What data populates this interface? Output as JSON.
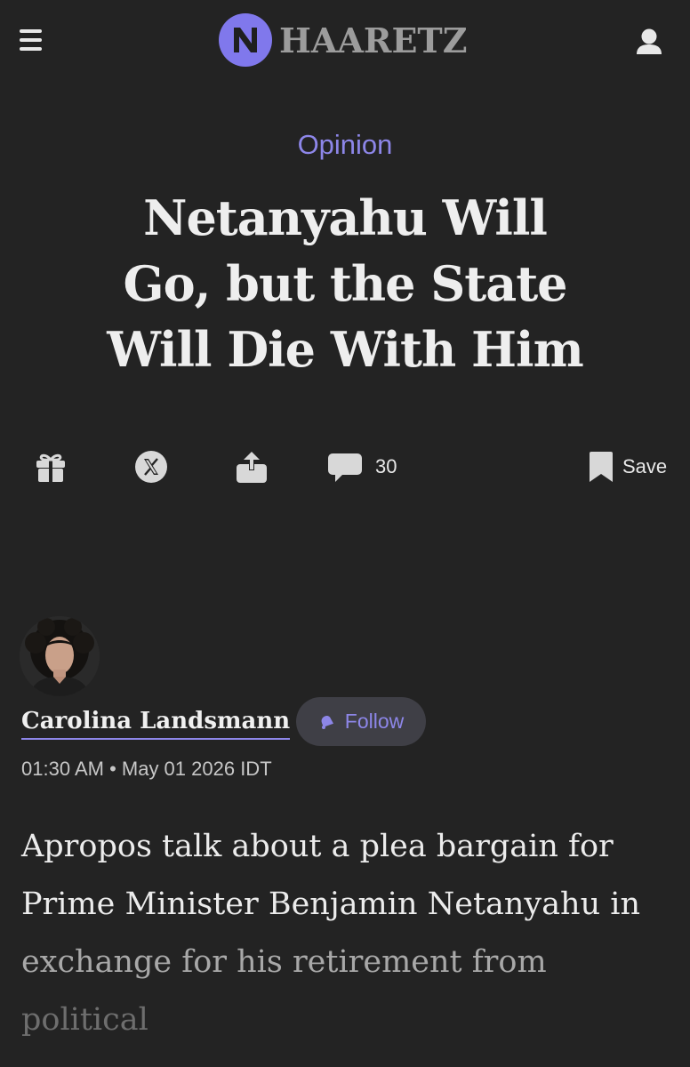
{
  "colors": {
    "background": "#232323",
    "accent": "#8d86e8",
    "logo_badge": "#8078ec",
    "logo_text": "#9c9c9c",
    "button_bg": "#3f3f46"
  },
  "header": {
    "logo_text": "HAARETZ",
    "menu_icon": "hamburger-menu-icon",
    "user_icon": "user-profile-icon"
  },
  "article": {
    "section": "Opinion",
    "headline_lines": [
      "Netanyahu Will",
      "Go, but the State",
      "Will Die With Him"
    ],
    "comments_count": "30",
    "save_label": "Save",
    "author": {
      "name": "Carolina Landsmann",
      "follow_label": "Follow"
    },
    "timestamp": "01:30 AM • May 01 2026 IDT",
    "body_lines": [
      "Apropos talk about a plea bargain for",
      "Prime Minister Benjamin Netanyahu in",
      "exchange for his retirement from",
      "political"
    ]
  },
  "icons": [
    "gift-icon",
    "x-share-icon",
    "share-icon",
    "comment-icon",
    "bookmark-icon",
    "bell-icon"
  ]
}
